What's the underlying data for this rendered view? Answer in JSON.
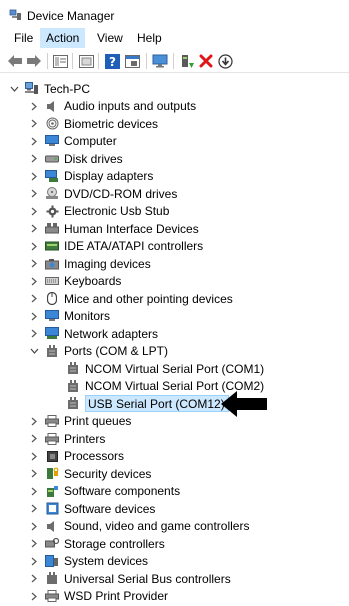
{
  "window": {
    "title": "Device Manager",
    "icon": "device-manager-icon"
  },
  "menu": [
    "File",
    "Action",
    "View",
    "Help"
  ],
  "menu_active": "Action",
  "toolbar": {
    "buttons": [
      "back-icon",
      "forward-icon",
      "properties-view-icon",
      "show-hide-icon",
      "help-icon",
      "panel-icon",
      "monitor-icon",
      "update-driver-icon",
      "uninstall-icon",
      "download-icon"
    ]
  },
  "tree": {
    "root": {
      "label": "Tech-PC",
      "icon": "computer-icon",
      "expanded": true
    },
    "items": [
      {
        "label": "Audio inputs and outputs",
        "icon": "speaker-icon",
        "expanded": false
      },
      {
        "label": "Biometric devices",
        "icon": "fingerprint-icon",
        "expanded": false
      },
      {
        "label": "Computer",
        "icon": "computer-monitor-icon",
        "expanded": false
      },
      {
        "label": "Disk drives",
        "icon": "disk-icon",
        "expanded": false
      },
      {
        "label": "Display adapters",
        "icon": "display-adapter-icon",
        "expanded": false
      },
      {
        "label": "DVD/CD-ROM drives",
        "icon": "dvd-icon",
        "expanded": false
      },
      {
        "label": "Electronic Usb Stub",
        "icon": "gear-icon",
        "expanded": false
      },
      {
        "label": "Human Interface Devices",
        "icon": "hid-icon",
        "expanded": false
      },
      {
        "label": "IDE ATA/ATAPI controllers",
        "icon": "ide-icon",
        "expanded": false
      },
      {
        "label": "Imaging devices",
        "icon": "camera-icon",
        "expanded": false
      },
      {
        "label": "Keyboards",
        "icon": "keyboard-icon",
        "expanded": false
      },
      {
        "label": "Mice and other pointing devices",
        "icon": "mouse-icon",
        "expanded": false
      },
      {
        "label": "Monitors",
        "icon": "monitor-icon",
        "expanded": false
      },
      {
        "label": "Network adapters",
        "icon": "network-icon",
        "expanded": false
      },
      {
        "label": "Ports (COM & LPT)",
        "icon": "port-icon",
        "expanded": true,
        "children": [
          {
            "label": "NCOM Virtual Serial Port (COM1)",
            "icon": "port-icon"
          },
          {
            "label": "NCOM Virtual Serial Port (COM2)",
            "icon": "port-icon"
          },
          {
            "label": "USB Serial Port (COM12)",
            "icon": "port-icon",
            "selected": true
          }
        ]
      },
      {
        "label": "Print queues",
        "icon": "printer-icon",
        "expanded": false
      },
      {
        "label": "Printers",
        "icon": "printer-icon",
        "expanded": false
      },
      {
        "label": "Processors",
        "icon": "processor-icon",
        "expanded": false
      },
      {
        "label": "Security devices",
        "icon": "security-icon",
        "expanded": false
      },
      {
        "label": "Software components",
        "icon": "software-component-icon",
        "expanded": false
      },
      {
        "label": "Software devices",
        "icon": "software-device-icon",
        "expanded": false
      },
      {
        "label": "Sound, video and game controllers",
        "icon": "speaker-icon",
        "expanded": false
      },
      {
        "label": "Storage controllers",
        "icon": "storage-icon",
        "expanded": false
      },
      {
        "label": "System devices",
        "icon": "system-icon",
        "expanded": false
      },
      {
        "label": "Universal Serial Bus controllers",
        "icon": "usb-icon",
        "expanded": false
      },
      {
        "label": "WSD Print Provider",
        "icon": "printer-icon",
        "expanded": false
      }
    ]
  },
  "colors": {
    "selection": "#cce8ff",
    "selection_border": "#99d1ff",
    "accent": "#0078d7"
  }
}
